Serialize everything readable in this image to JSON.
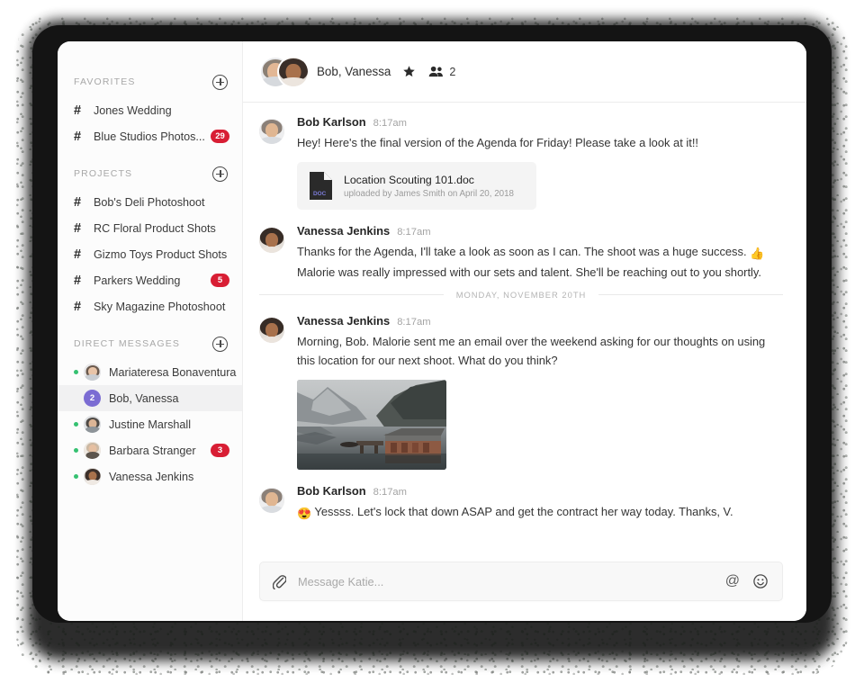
{
  "window": {
    "frame_color": "#141414",
    "sidebar_bg": "#fcfcfc",
    "accent_red": "#d81e34",
    "accent_purple": "#7b6cd3",
    "presence_green": "#35c171"
  },
  "sidebar": {
    "sections": [
      {
        "title": "FAVORITES",
        "add_icon": "plus-circle-icon",
        "items": [
          {
            "hash": "#",
            "label": "Jones Wedding",
            "badge": null
          },
          {
            "hash": "#",
            "label": "Blue Studios Photos...",
            "badge": "29"
          }
        ]
      },
      {
        "title": "PROJECTS",
        "add_icon": "plus-circle-icon",
        "items": [
          {
            "hash": "#",
            "label": "Bob's Deli Photoshoot",
            "badge": null
          },
          {
            "hash": "#",
            "label": "RC Floral Product Shots",
            "badge": null
          },
          {
            "hash": "#",
            "label": "Gizmo Toys Product Shots",
            "badge": null
          },
          {
            "hash": "#",
            "label": "Parkers Wedding",
            "badge": "5"
          },
          {
            "hash": "#",
            "label": "Sky Magazine Photoshoot",
            "badge": null
          }
        ]
      }
    ],
    "direct_messages": {
      "title": "DIRECT MESSAGES",
      "add_icon": "plus-circle-icon",
      "items": [
        {
          "label": "Mariateresa Bonaventura",
          "online": true,
          "badge": null,
          "selected": false,
          "count_avatar": null
        },
        {
          "label": "Bob, Vanessa",
          "online": false,
          "badge": null,
          "selected": true,
          "count_avatar": "2"
        },
        {
          "label": "Justine Marshall",
          "online": true,
          "badge": null,
          "selected": false,
          "count_avatar": null
        },
        {
          "label": "Barbara Stranger",
          "online": true,
          "badge": "3",
          "selected": false,
          "count_avatar": null
        },
        {
          "label": "Vanessa Jenkins",
          "online": true,
          "badge": null,
          "selected": false,
          "count_avatar": null
        }
      ]
    }
  },
  "chat": {
    "header": {
      "title": "Bob, Vanessa",
      "star_icon": "star-icon",
      "people_icon": "people-icon",
      "member_count": "2"
    },
    "messages": [
      {
        "author": "Bob Karlson",
        "time": "8:17am",
        "text": "Hey! Here's the final version of the Agenda for Friday! Please take a look at it!!",
        "attachment": {
          "icon": "doc-file-icon",
          "icon_label": "DOC",
          "name": "Location Scouting 101.doc",
          "meta": "uploaded by James Smith on April 20, 2018"
        }
      },
      {
        "author": "Vanessa Jenkins",
        "time": "8:17am",
        "text_line_1": "Thanks for the Agenda, I'll take a look as soon as I can. The shoot was a huge success.",
        "emoji_1": "👍",
        "text_line_2": "Malorie was really impressed with our sets and talent. She'll be reaching out to you shortly."
      },
      {
        "divider": "MONDAY, NOVEMBER 20TH"
      },
      {
        "author": "Vanessa Jenkins",
        "time": "8:17am",
        "text": "Morning, Bob. Malorie sent me an email over the weekend asking for our thoughts on using this location for our next shoot. What do you think?",
        "image_alt": "mountain-lake-boathouse-photo"
      },
      {
        "author": "Bob Karlson",
        "time": "8:17am",
        "emoji_prefix": "😍",
        "text": "Yessss. Let's lock that down ASAP and get the contract her way today. Thanks, V."
      }
    ],
    "composer": {
      "attach_icon": "paperclip-icon",
      "placeholder": "Message Katie...",
      "value": "",
      "mention_icon": "at-icon",
      "mention_label": "@",
      "emoji_icon": "smiley-icon"
    }
  }
}
